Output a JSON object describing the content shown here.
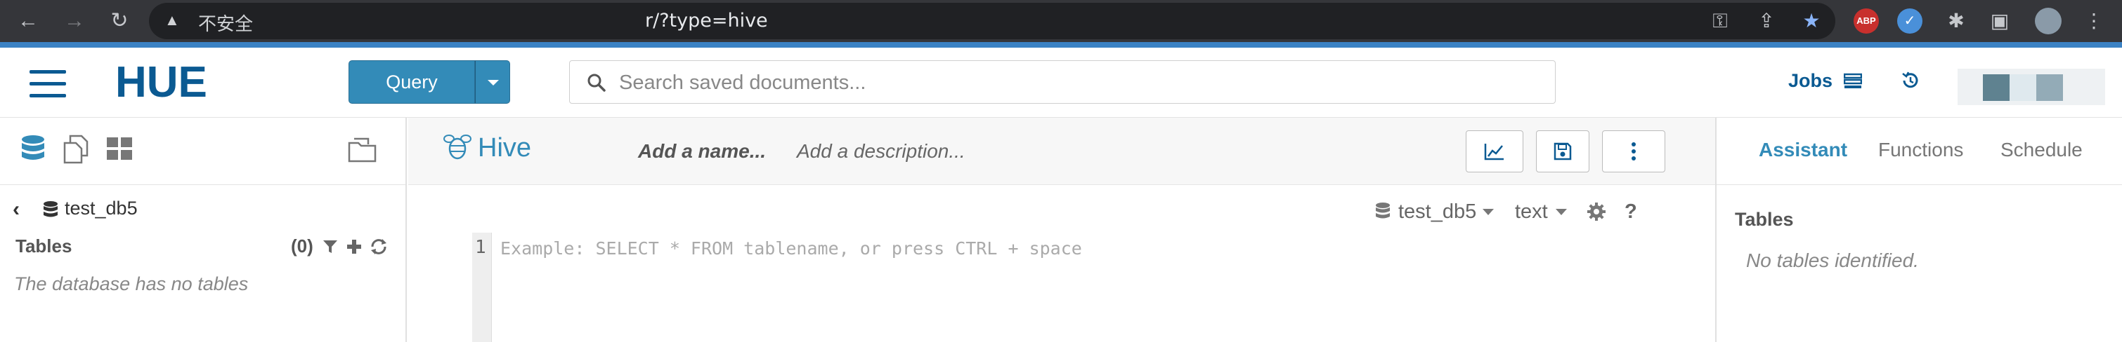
{
  "browser": {
    "security_label": "不安全",
    "url": "r/?type=hive",
    "extensions": [
      "key-icon",
      "share-icon",
      "bookmark-star-icon",
      "abp-extension-icon",
      "blue-extension-icon",
      "puzzle-extensions-icon",
      "sidebar-icon",
      "profile-avatar",
      "kebab-menu-icon"
    ],
    "abp_label": "ABP"
  },
  "app": {
    "brand": "HUE",
    "query_button": "Query",
    "search_placeholder": "Search saved documents...",
    "jobs_label": "Jobs",
    "accent_color": "#338bb8"
  },
  "left_panel": {
    "database": "test_db5",
    "tables_label": "Tables",
    "tables_count": "(0)",
    "empty_message": "The database has no tables"
  },
  "editor": {
    "dialect": "Hive",
    "name_placeholder": "Add a name...",
    "description_placeholder": "Add a description...",
    "context_database": "test_db5",
    "context_format": "text",
    "line_number": "1",
    "code_placeholder": "Example: SELECT * FROM tablename, or press CTRL + space"
  },
  "right_panel": {
    "tabs": [
      "Assistant",
      "Functions",
      "Schedule"
    ],
    "active_tab": "Assistant",
    "tables_label": "Tables",
    "empty_message": "No tables identified."
  }
}
